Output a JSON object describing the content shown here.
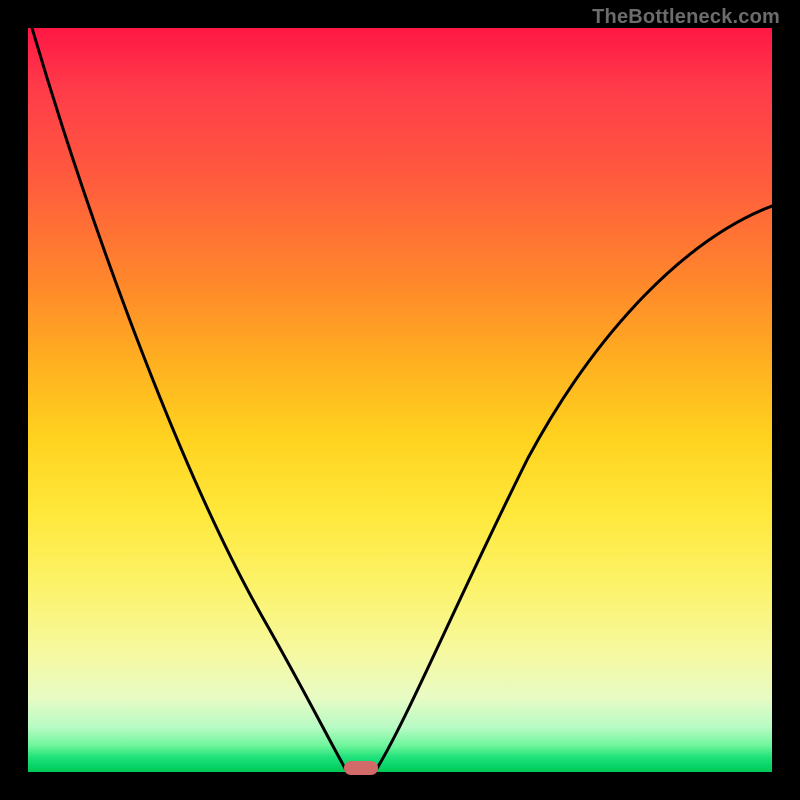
{
  "watermark": "TheBottleneck.com",
  "chart_data": {
    "type": "line",
    "title": "",
    "xlabel": "",
    "ylabel": "",
    "xlim": [
      0,
      100
    ],
    "ylim": [
      0,
      100
    ],
    "background_gradient": {
      "top_color": "#ff1744",
      "mid_color": "#ffe83a",
      "bottom_color": "#00c853",
      "meaning": "risk/bottleneck severity (red high, green low)"
    },
    "series": [
      {
        "name": "left-curve",
        "x": [
          0,
          5,
          10,
          15,
          20,
          25,
          30,
          35,
          38,
          40,
          42,
          43
        ],
        "values": [
          100,
          90,
          79,
          68,
          56,
          44,
          32,
          20,
          12,
          6,
          2,
          0
        ]
      },
      {
        "name": "right-curve",
        "x": [
          45,
          48,
          52,
          58,
          65,
          73,
          82,
          90,
          96,
          100
        ],
        "values": [
          0,
          5,
          12,
          22,
          34,
          47,
          59,
          68,
          73,
          76
        ]
      }
    ],
    "marker": {
      "name": "optimal-region",
      "x": 44,
      "y": 0,
      "color": "#d36a6a",
      "shape": "rounded-pill"
    }
  }
}
